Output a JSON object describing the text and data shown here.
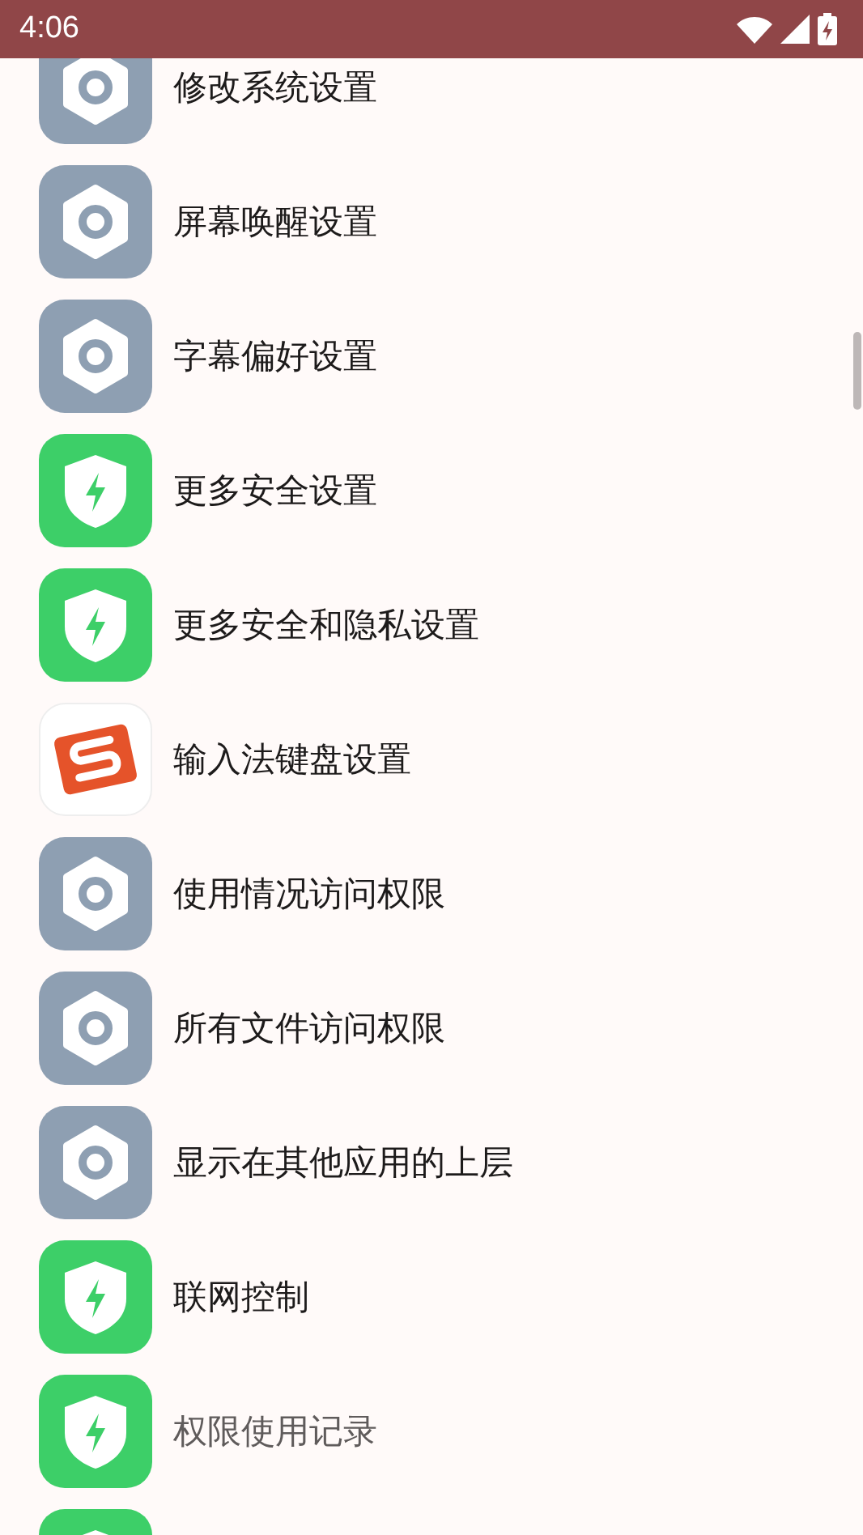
{
  "status_bar": {
    "time": "4:06"
  },
  "items": [
    {
      "kind": "settings",
      "label": "修改系统设置",
      "disabled": false
    },
    {
      "kind": "settings",
      "label": "屏幕唤醒设置",
      "disabled": false
    },
    {
      "kind": "settings",
      "label": "字幕偏好设置",
      "disabled": false
    },
    {
      "kind": "shield",
      "label": "更多安全设置",
      "disabled": false
    },
    {
      "kind": "shield",
      "label": "更多安全和隐私设置",
      "disabled": false
    },
    {
      "kind": "input-app",
      "label": "输入法键盘设置",
      "disabled": false
    },
    {
      "kind": "settings",
      "label": "使用情况访问权限",
      "disabled": false
    },
    {
      "kind": "settings",
      "label": "所有文件访问权限",
      "disabled": false
    },
    {
      "kind": "settings",
      "label": "显示在其他应用的上层",
      "disabled": false
    },
    {
      "kind": "shield",
      "label": "联网控制",
      "disabled": false
    },
    {
      "kind": "shield",
      "label": "权限使用记录",
      "disabled": true
    },
    {
      "kind": "shield"
    }
  ]
}
